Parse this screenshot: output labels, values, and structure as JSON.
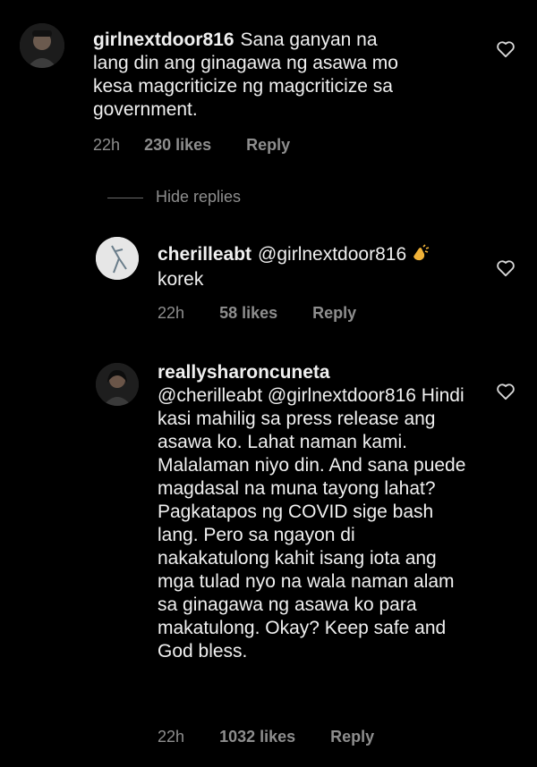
{
  "comments": [
    {
      "username": "girlnextdoor816",
      "text": "Sana ganyan na lang din ang ginagawa ng asawa mo kesa magcriticize ng magcriticize sa government.",
      "time": "22h",
      "likes": "230 likes",
      "reply": "Reply",
      "avatar_icon": "profile-photo-man-icon"
    },
    {
      "username": "cherilleabt",
      "mention": "@girlnextdoor816",
      "emoji": "clapping-hands",
      "text": "korek",
      "time": "22h",
      "likes": "58 likes",
      "reply": "Reply",
      "avatar_icon": "profile-photo-sketch-icon"
    },
    {
      "username": "reallysharoncuneta",
      "text": "@cherilleabt @girlnextdoor816 Hindi kasi mahilig sa press release ang asawa ko. Lahat naman kami. Malalaman niyo din. And sana puede magdasal na muna tayong lahat? Pagkatapos ng COVID sige bash lang. Pero sa ngayon di nakakatulong kahit isang iota ang mga tulad nyo na wala naman alam sa ginagawa ng asawa ko para makatulong. Okay? Keep safe and God bless.",
      "time": "22h",
      "likes": "1032 likes",
      "reply": "Reply",
      "avatar_icon": "profile-photo-woman-icon"
    }
  ],
  "hide_replies": "Hide replies",
  "colors": {
    "background": "#000000",
    "text": "#f0f0f0",
    "meta": "#8e8e8e"
  }
}
